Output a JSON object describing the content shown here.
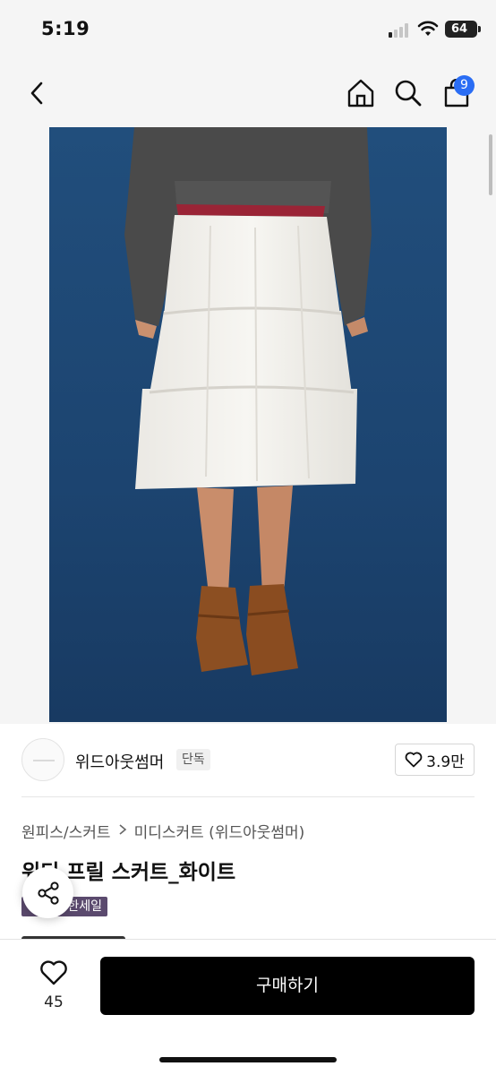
{
  "status_bar": {
    "time": "5:19",
    "battery": "64",
    "icons": [
      "cellular-signal-icon",
      "wifi-icon",
      "battery-icon"
    ]
  },
  "nav": {
    "icons": [
      "back-chevron-icon",
      "home-icon",
      "search-icon",
      "shopping-bag-icon"
    ],
    "cart_count": "9"
  },
  "product_image": {
    "description_icon": "product-photo"
  },
  "seller": {
    "name": "위드아웃썸머",
    "badge": "단독",
    "likes": "3.9만"
  },
  "breadcrumb": {
    "items": [
      "원피스/스커트",
      "미디스커트 (위드아웃썸머)"
    ],
    "separator_icon": "chevron-right-icon"
  },
  "product": {
    "title": "위디 프릴 스커트_화이트",
    "sale_tag": "한세일"
  },
  "share": {
    "icon": "share-icon"
  },
  "bottom_bar": {
    "wish_count": "45",
    "buy_label": "구매하기"
  },
  "colors": {
    "accent_badge": "#2a6df4",
    "buy_button": "#000000",
    "sale_tag": "#5b4a6e",
    "photo_background": "#1c4672"
  }
}
